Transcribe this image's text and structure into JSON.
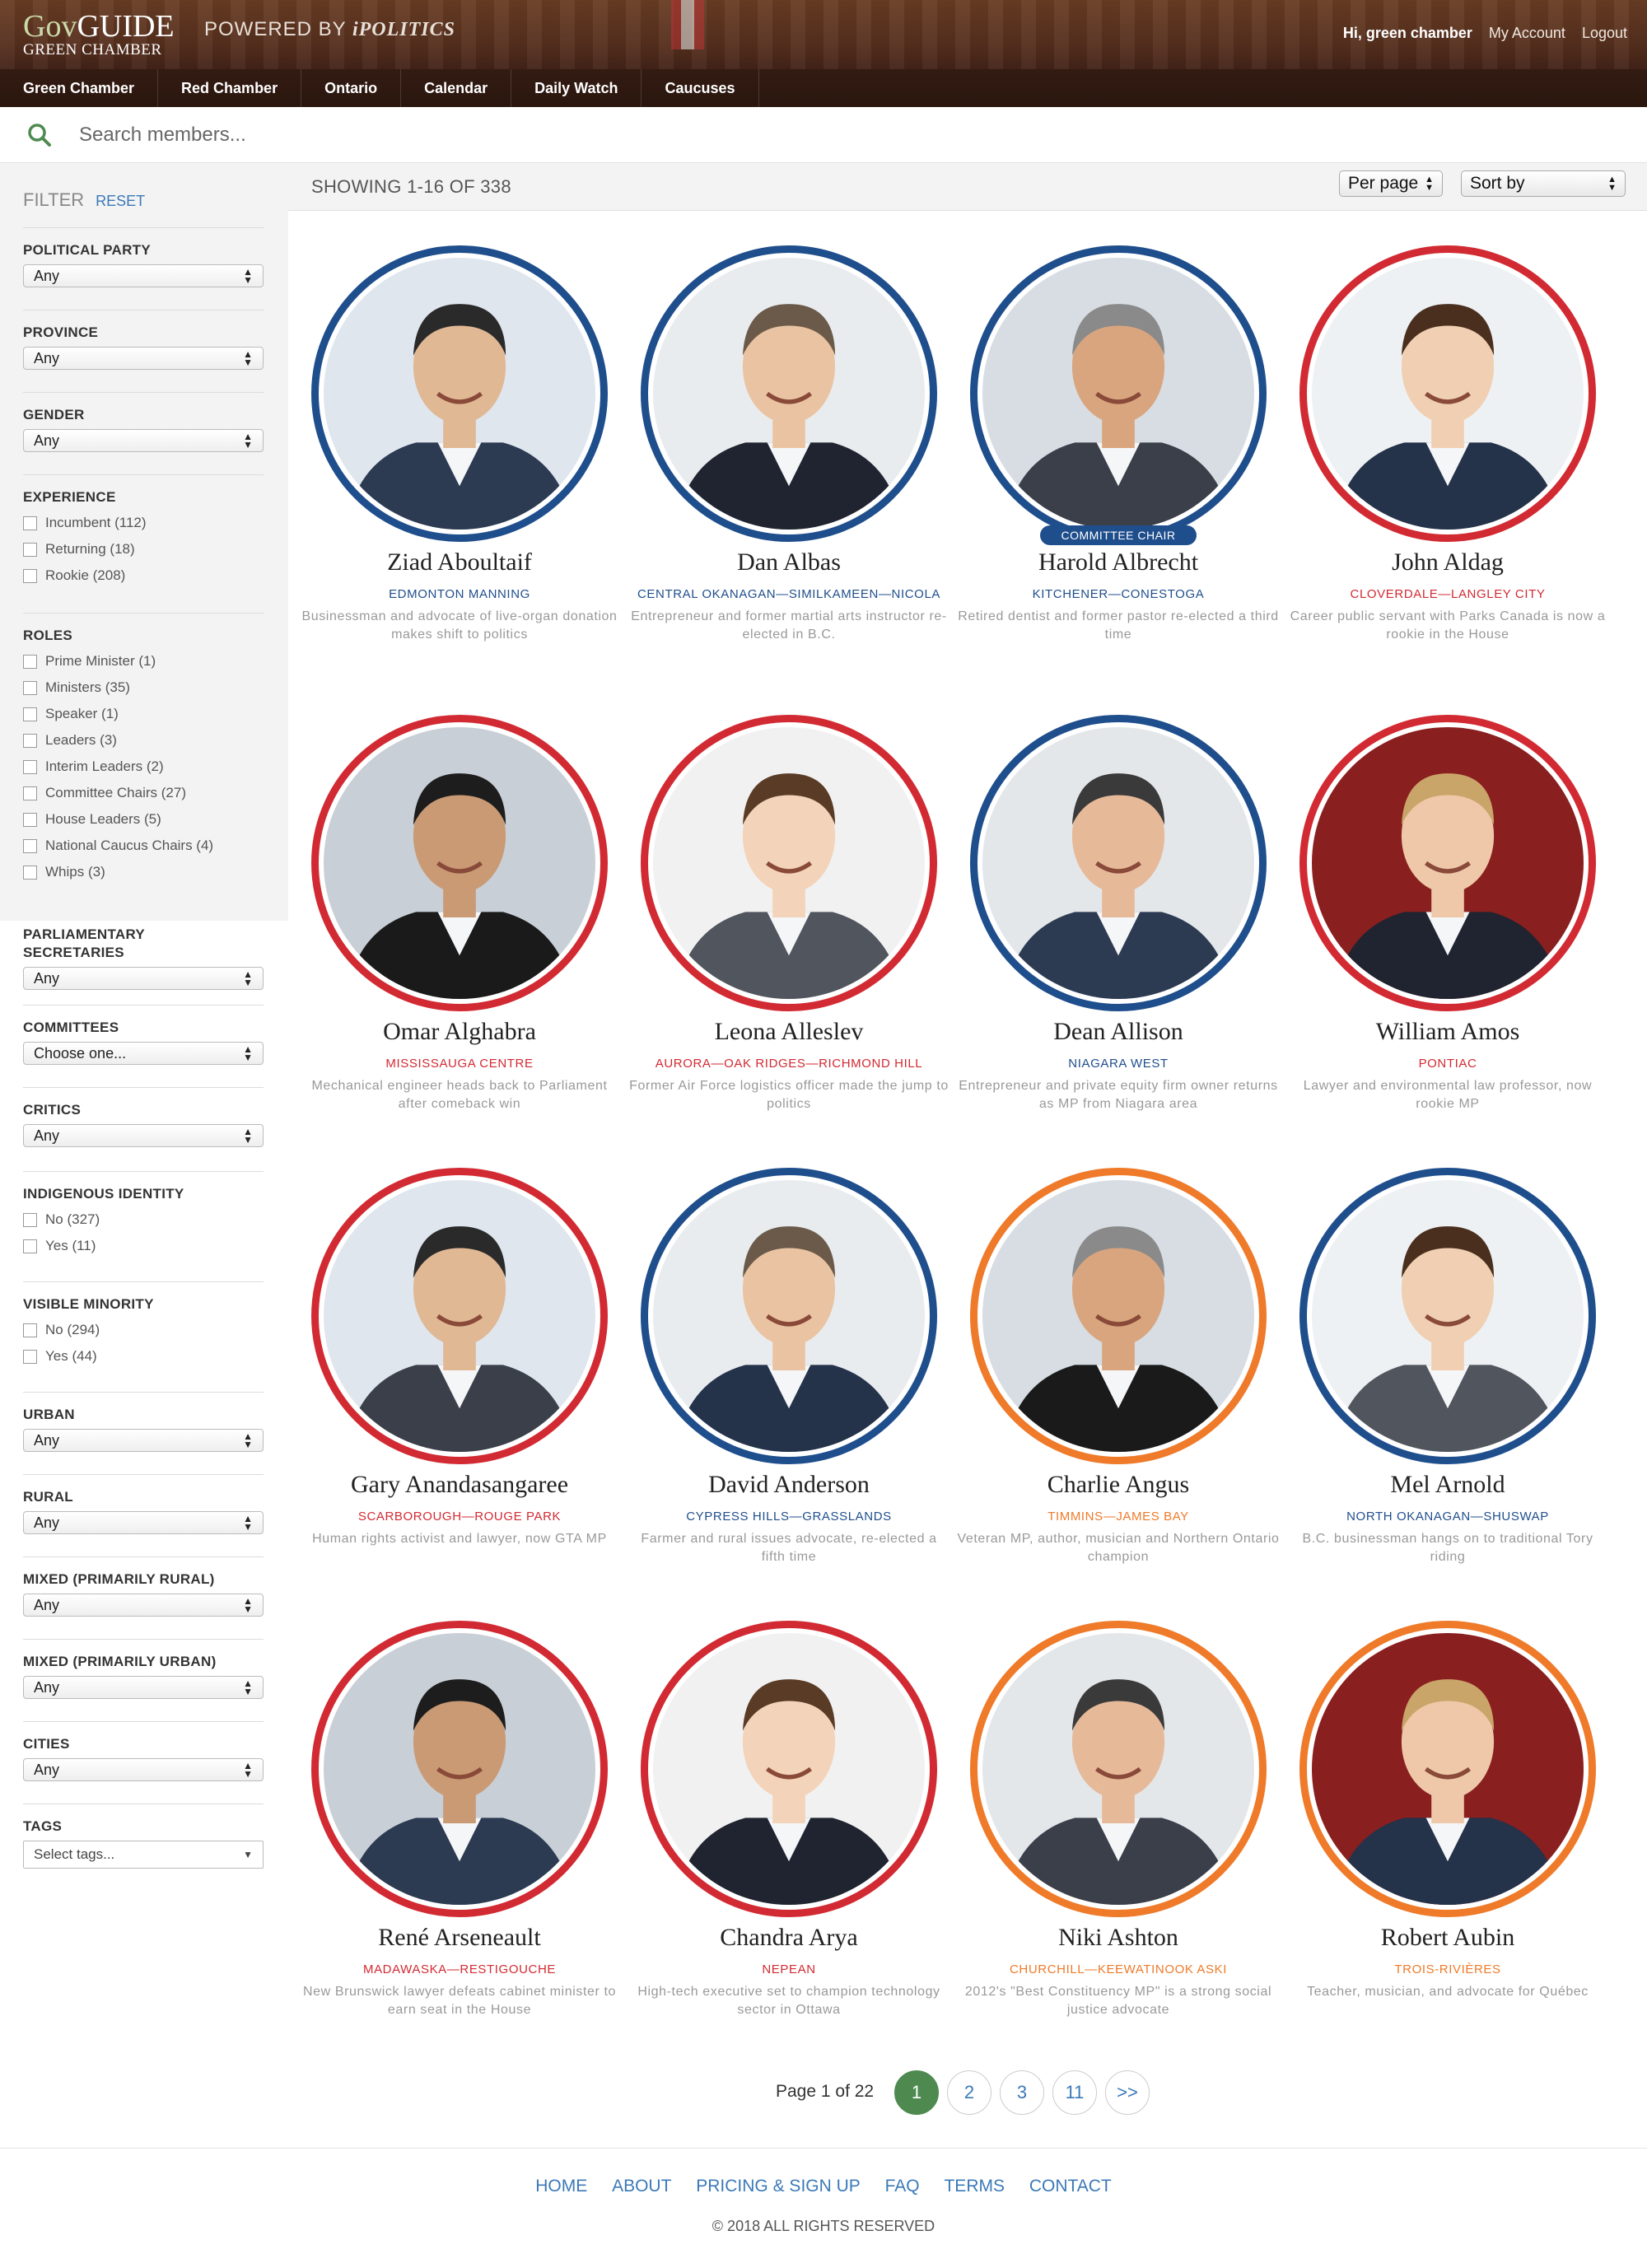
{
  "header": {
    "logo_main_gov": "Gov",
    "logo_main_guide": "GUIDE",
    "logo_sub": "GREEN CHAMBER",
    "powered_prefix": "POWERED BY",
    "powered_brand": "iPOLITICS",
    "greeting": "Hi, green chamber",
    "my_account": "My Account",
    "logout": "Logout"
  },
  "nav": [
    "Green Chamber",
    "Red Chamber",
    "Ontario",
    "Calendar",
    "Daily Watch",
    "Caucuses"
  ],
  "search": {
    "placeholder": "Search members..."
  },
  "filter": {
    "title": "FILTER",
    "reset": "RESET",
    "political_party": {
      "label": "POLITICAL PARTY",
      "value": "Any"
    },
    "province": {
      "label": "PROVINCE",
      "value": "Any"
    },
    "gender": {
      "label": "GENDER",
      "value": "Any"
    },
    "experience": {
      "label": "EXPERIENCE",
      "options": [
        "Incumbent (112)",
        "Returning (18)",
        "Rookie (208)"
      ]
    },
    "roles": {
      "label": "ROLES",
      "options": [
        "Prime Minister (1)",
        "Ministers (35)",
        "Speaker (1)",
        "Leaders (3)",
        "Interim Leaders (2)",
        "Committee Chairs (27)",
        "House Leaders (5)",
        "National Caucus Chairs (4)",
        "Whips (3)"
      ]
    },
    "parl_secretaries": {
      "label_1": "PARLIAMENTARY",
      "label_2": "SECRETARIES",
      "value": "Any"
    },
    "committees": {
      "label": "COMMITTEES",
      "value": "Choose one..."
    },
    "critics": {
      "label": "CRITICS",
      "value": "Any"
    },
    "indigenous": {
      "label": "INDIGENOUS IDENTITY",
      "options": [
        "No (327)",
        "Yes (11)"
      ]
    },
    "visible_minority": {
      "label": "VISIBLE MINORITY",
      "options": [
        "No (294)",
        "Yes (44)"
      ]
    },
    "urban": {
      "label": "URBAN",
      "value": "Any"
    },
    "rural": {
      "label": "RURAL",
      "value": "Any"
    },
    "mixed_rural": {
      "label": "MIXED (PRIMARILY RURAL)",
      "value": "Any"
    },
    "mixed_urban": {
      "label": "MIXED (PRIMARILY URBAN)",
      "value": "Any"
    },
    "cities": {
      "label": "CITIES",
      "value": "Any"
    },
    "tags": {
      "label": "TAGS",
      "value": "Select tags..."
    }
  },
  "results": {
    "showing": "SHOWING 1-16 OF 338",
    "per_page": "Per page",
    "sort_by": "Sort by"
  },
  "members": [
    {
      "name": "Ziad Aboultaif",
      "riding": "EDMONTON MANNING",
      "blurb": "Businessman and advocate of live-organ donation makes shift to politics",
      "party": "conservative"
    },
    {
      "name": "Dan Albas",
      "riding": "CENTRAL OKANAGAN—SIMILKAMEEN—NICOLA",
      "blurb": "Entrepreneur and former martial arts instructor re-elected in B.C.",
      "party": "conservative"
    },
    {
      "name": "Harold Albrecht",
      "riding": "KITCHENER—CONESTOGA",
      "blurb": "Retired dentist and former pastor re-elected a third time",
      "party": "conservative",
      "badge": "COMMITTEE CHAIR"
    },
    {
      "name": "John Aldag",
      "riding": "CLOVERDALE—LANGLEY CITY",
      "blurb": "Career public servant with Parks Canada is now a rookie in the House",
      "party": "liberal"
    },
    {
      "name": "Omar Alghabra",
      "riding": "MISSISSAUGA CENTRE",
      "blurb": "Mechanical engineer heads back to Parliament after comeback win",
      "party": "liberal"
    },
    {
      "name": "Leona Alleslev",
      "riding": "AURORA—OAK RIDGES—RICHMOND HILL",
      "blurb": "Former Air Force logistics officer made the jump to politics",
      "party": "liberal"
    },
    {
      "name": "Dean Allison",
      "riding": "NIAGARA WEST",
      "blurb": "Entrepreneur and private equity firm owner returns as MP from Niagara area",
      "party": "conservative"
    },
    {
      "name": "William Amos",
      "riding": "PONTIAC",
      "blurb": "Lawyer and environmental law professor, now rookie MP",
      "party": "liberal"
    },
    {
      "name": "Gary Anandasangaree",
      "riding": "SCARBOROUGH—ROUGE PARK",
      "blurb": "Human rights activist and lawyer, now GTA MP",
      "party": "liberal"
    },
    {
      "name": "David Anderson",
      "riding": "CYPRESS HILLS—GRASSLANDS",
      "blurb": "Farmer and rural issues advocate, re-elected a fifth time",
      "party": "conservative"
    },
    {
      "name": "Charlie Angus",
      "riding": "TIMMINS—JAMES BAY",
      "blurb": "Veteran MP, author, musician and Northern Ontario champion",
      "party": "ndp"
    },
    {
      "name": "Mel Arnold",
      "riding": "NORTH OKANAGAN—SHUSWAP",
      "blurb": "B.C. businessman hangs on to traditional Tory riding",
      "party": "conservative"
    },
    {
      "name": "René Arseneault",
      "riding": "MADAWASKA—RESTIGOUCHE",
      "blurb": "New Brunswick lawyer defeats cabinet minister to earn seat in the House",
      "party": "liberal"
    },
    {
      "name": "Chandra Arya",
      "riding": "NEPEAN",
      "blurb": "High-tech executive set to champion technology sector in Ottawa",
      "party": "liberal"
    },
    {
      "name": "Niki Ashton",
      "riding": "CHURCHILL—KEEWATINOOK ASKI",
      "blurb": "2012's \"Best Constituency MP\" is a strong social justice advocate",
      "party": "ndp"
    },
    {
      "name": "Robert Aubin",
      "riding": "TROIS-RIVIÈRES",
      "blurb": "Teacher, musician, and advocate for Québec",
      "party": "ndp"
    }
  ],
  "pagination": {
    "label": "Page 1 of 22",
    "pages": [
      "1",
      "2",
      "3",
      "11",
      ">>"
    ]
  },
  "footer": {
    "links": [
      "HOME",
      "ABOUT",
      "PRICING & SIGN UP",
      "FAQ",
      "TERMS",
      "CONTACT"
    ],
    "copyright": "© 2018 ALL RIGHTS RESERVED"
  },
  "colors": {
    "conservative": "#1f4e8c",
    "liberal": "#d22a32",
    "ndp": "#ee7a2a",
    "active_page": "#4e8a50",
    "link": "#3b79b8"
  }
}
